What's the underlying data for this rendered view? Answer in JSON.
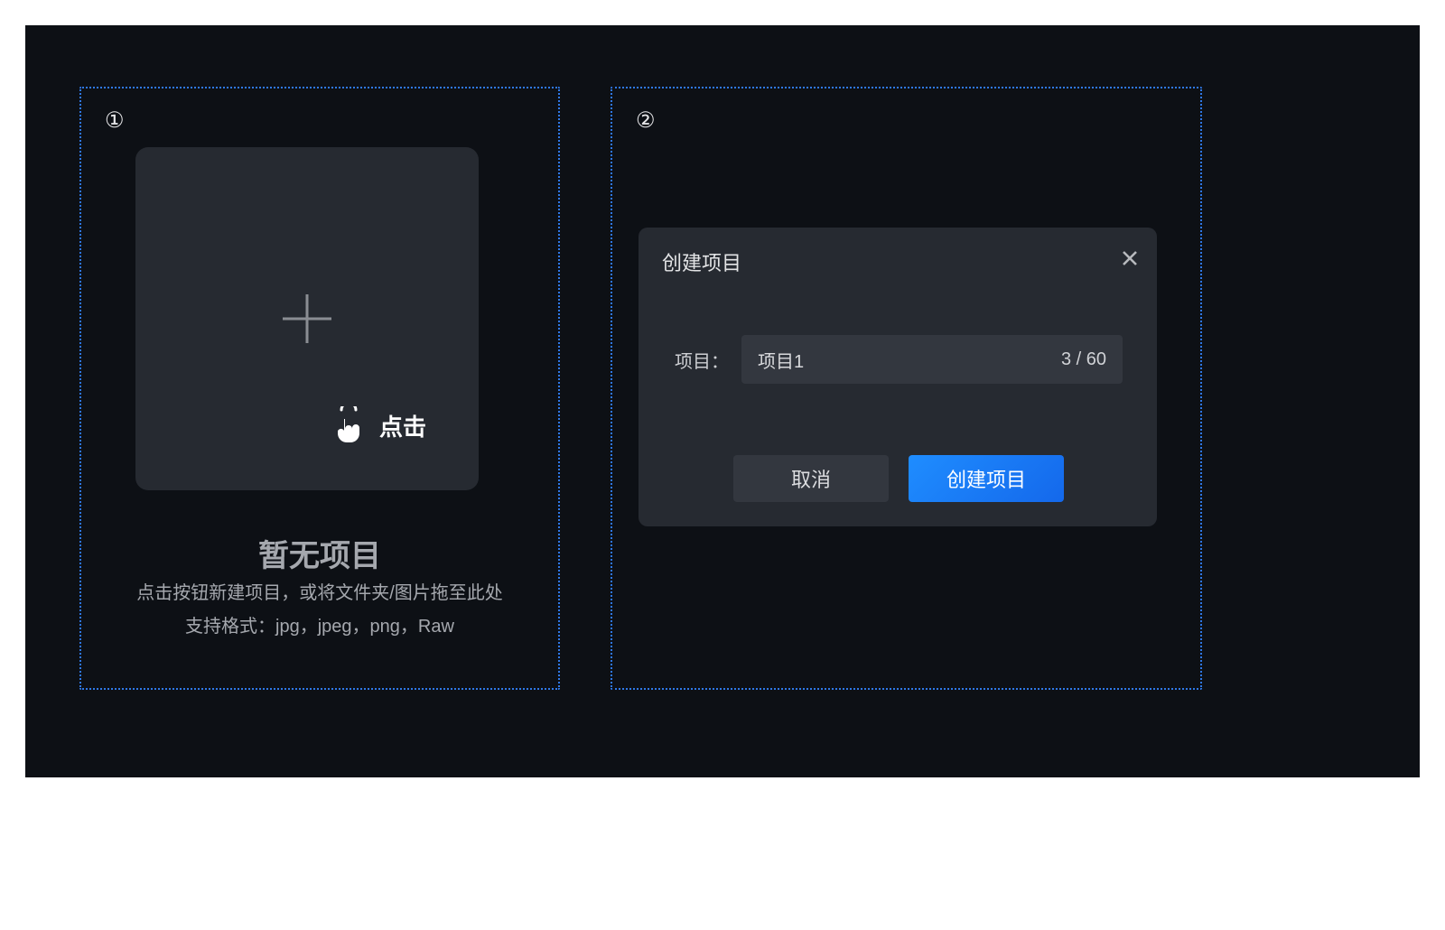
{
  "panel1": {
    "step_number": "①",
    "click_hint": "点击",
    "empty_title": "暂无项目",
    "empty_sub_1": "点击按钮新建项目，或将文件夹/图片拖至此处",
    "empty_sub_2": "支持格式：jpg，jpeg，png，Raw"
  },
  "panel2": {
    "step_number": "②",
    "dialog": {
      "title": "创建项目",
      "field_label": "项目：",
      "field_value": "项目1",
      "counter": "3 / 60",
      "cancel": "取消",
      "confirm": "创建项目"
    }
  }
}
